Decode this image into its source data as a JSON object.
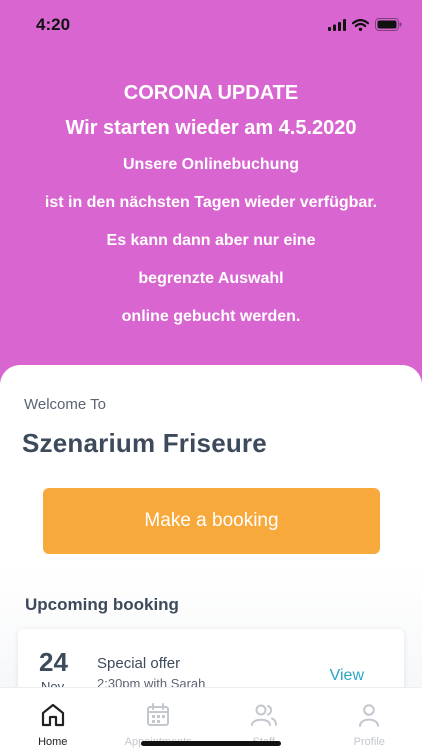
{
  "status_bar": {
    "time": "4:20",
    "icons": [
      "signal-icon",
      "wifi-icon",
      "battery-icon"
    ]
  },
  "banner": {
    "title": "CORONA UPDATE",
    "subtitle": "Wir starten wieder am 4.5.2020",
    "lines": [
      "Unsere Onlinebuchung",
      "ist in den nächsten Tagen wieder verfügbar.",
      "Es kann dann aber nur eine",
      "begrenzte Auswahl",
      "online gebucht werden."
    ]
  },
  "main": {
    "welcome_label": "Welcome To",
    "salon_name": "Szenarium Friseure",
    "booking_button_label": "Make a booking",
    "upcoming_title": "Upcoming booking",
    "upcoming": {
      "day": "24",
      "month": "Nov",
      "title": "Special offer",
      "subtitle": "2:30pm with Sarah",
      "action_label": "View"
    }
  },
  "tab_bar": {
    "tabs": [
      {
        "label": "Home",
        "icon": "home-icon",
        "active": true
      },
      {
        "label": "Appointments",
        "icon": "calendar-icon",
        "active": false
      },
      {
        "label": "Staff",
        "icon": "staff-icon",
        "active": false
      },
      {
        "label": "Profile",
        "icon": "profile-icon",
        "active": false
      }
    ]
  },
  "colors": {
    "banner_background": "#d966d0",
    "accent": "#f8a93c",
    "link": "#2aa6c4",
    "heading": "#3d4a5c",
    "inactive_tab": "#c3c7ce"
  }
}
